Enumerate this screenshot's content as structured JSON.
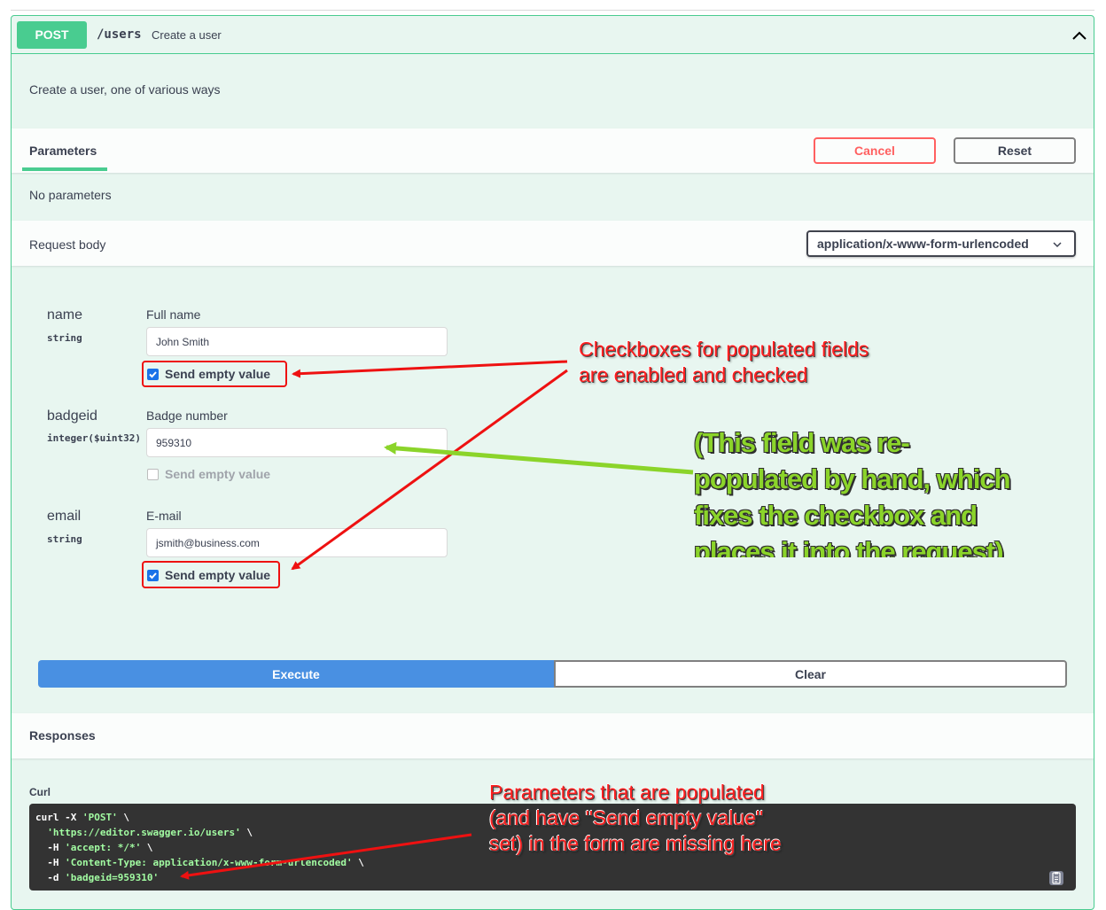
{
  "operation": {
    "method": "POST",
    "path": "/users",
    "summary": "Create a user",
    "description": "Create a user, one of various ways"
  },
  "parameters": {
    "tab_label": "Parameters",
    "cancel_label": "Cancel",
    "reset_label": "Reset",
    "empty_text": "No parameters"
  },
  "request_body": {
    "title": "Request body",
    "content_type": "application/x-www-form-urlencoded",
    "fields": [
      {
        "name": "name",
        "type": "string",
        "description": "Full name",
        "value": "John Smith",
        "send_empty_label": "Send empty value",
        "send_empty_checked": true,
        "send_empty_disabled": false
      },
      {
        "name": "badgeid",
        "type": "integer($uint32)",
        "description": "Badge number",
        "value": "959310",
        "send_empty_label": "Send empty value",
        "send_empty_checked": false,
        "send_empty_disabled": true
      },
      {
        "name": "email",
        "type": "string",
        "description": "E-mail",
        "value": "jsmith@business.com",
        "send_empty_label": "Send empty value",
        "send_empty_checked": true,
        "send_empty_disabled": false
      }
    ]
  },
  "actions": {
    "execute_label": "Execute",
    "clear_label": "Clear"
  },
  "responses": {
    "title": "Responses",
    "curl_label": "Curl",
    "curl_lines": [
      {
        "plain": "curl -X ",
        "str": "'POST'",
        "tail": " \\"
      },
      {
        "plain": "  ",
        "str": "'https://editor.swagger.io/users'",
        "tail": " \\"
      },
      {
        "plain": "  -H ",
        "str": "'accept: */*'",
        "tail": " \\"
      },
      {
        "plain": "  -H ",
        "str": "'Content-Type: application/x-www-form-urlencoded'",
        "tail": " \\"
      },
      {
        "plain": "  -d ",
        "str": "'badgeid=959310'",
        "tail": ""
      }
    ]
  },
  "annotations": {
    "checkboxes_note": [
      "Checkboxes for populated fields",
      "are enabled and checked"
    ],
    "hand_note": [
      "(This field was re-",
      "populated by hand, which",
      "fixes the checkbox and",
      "places it into the request)"
    ],
    "missing_note": [
      "Parameters that are populated",
      "(and have \"Send empty value\"",
      "set) in the form are missing here"
    ],
    "colors": {
      "red": "#ff2020",
      "green": "#8bd42a",
      "post_green": "#49cc90",
      "execute_blue": "#4990e2"
    }
  }
}
